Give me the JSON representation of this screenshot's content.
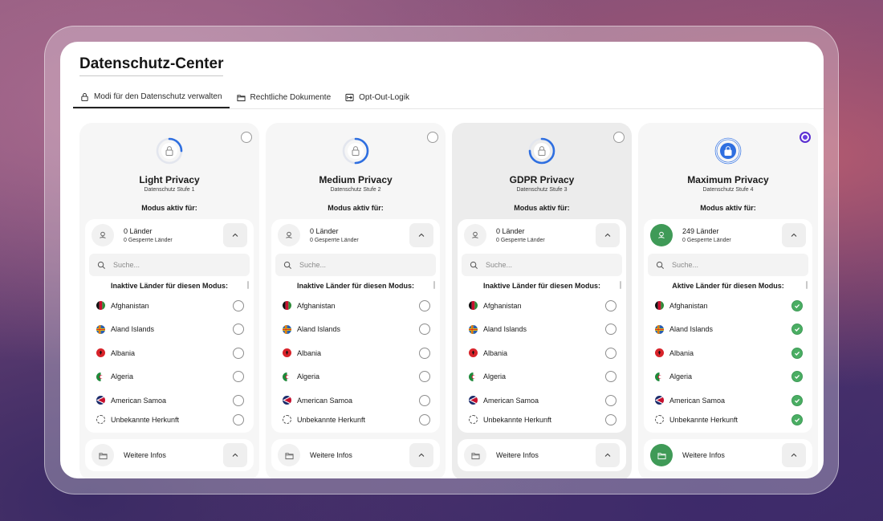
{
  "app": {
    "title": "Datenschutz-Center"
  },
  "tabs": [
    {
      "label": "Modi für den Datenschutz verwalten",
      "icon": "lock-icon"
    },
    {
      "label": "Rechtliche Dokumente",
      "icon": "folder-icon"
    },
    {
      "label": "Opt-Out-Logik",
      "icon": "logout-icon"
    }
  ],
  "labels": {
    "active_for": "Modus aktiv für:",
    "search_placeholder": "Suche...",
    "more_info": "Weitere Infos"
  },
  "colors": {
    "accent_blue": "#2f6fe0",
    "success_green": "#4aae63",
    "selected_purple": "#6a3ee0"
  },
  "cards": [
    {
      "title": "Light Privacy",
      "subtitle": "Datenschutz Stufe 1",
      "countries": "0 Länder",
      "blocked": "0 Gesperrte Länder",
      "list_heading": "Inaktive Länder für diesen Modus:",
      "selected": false,
      "level": 0.25
    },
    {
      "title": "Medium Privacy",
      "subtitle": "Datenschutz Stufe 2",
      "countries": "0 Länder",
      "blocked": "0 Gesperrte Länder",
      "list_heading": "Inaktive Länder für diesen Modus:",
      "selected": false,
      "level": 0.5
    },
    {
      "title": "GDPR Privacy",
      "subtitle": "Datenschutz Stufe 3",
      "countries": "0 Länder",
      "blocked": "0 Gesperrte Länder",
      "list_heading": "Inaktive Länder für diesen Modus:",
      "selected": false,
      "level": 0.75
    },
    {
      "title": "Maximum Privacy",
      "subtitle": "Datenschutz Stufe 4",
      "countries": "249 Länder",
      "blocked": "0 Gesperrte Länder",
      "list_heading": "Aktive Länder für diesen Modus:",
      "selected": true,
      "level": 1.0
    }
  ],
  "countries": [
    {
      "name": "Afghanistan",
      "flag": "afghanistan-flag-icon"
    },
    {
      "name": "Aland Islands",
      "flag": "aland-islands-flag-icon"
    },
    {
      "name": "Albania",
      "flag": "albania-flag-icon"
    },
    {
      "name": "Algeria",
      "flag": "algeria-flag-icon"
    },
    {
      "name": "American Samoa",
      "flag": "american-samoa-flag-icon"
    },
    {
      "name": "Unbekannte Herkunft",
      "flag": "unknown-origin-icon"
    }
  ]
}
